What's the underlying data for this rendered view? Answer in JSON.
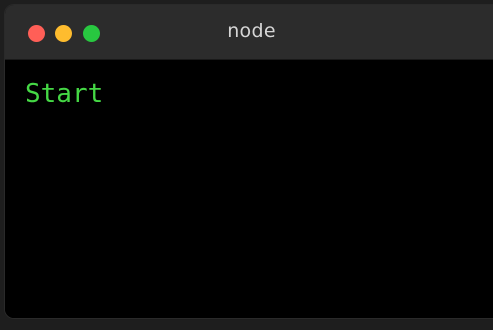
{
  "window": {
    "title": "node",
    "controls": {
      "close": "#ff5f57",
      "minimize": "#febc2e",
      "zoom": "#28c840"
    }
  },
  "terminal": {
    "output": [
      "Start"
    ],
    "text_color": "#45d845",
    "background": "#000000"
  }
}
